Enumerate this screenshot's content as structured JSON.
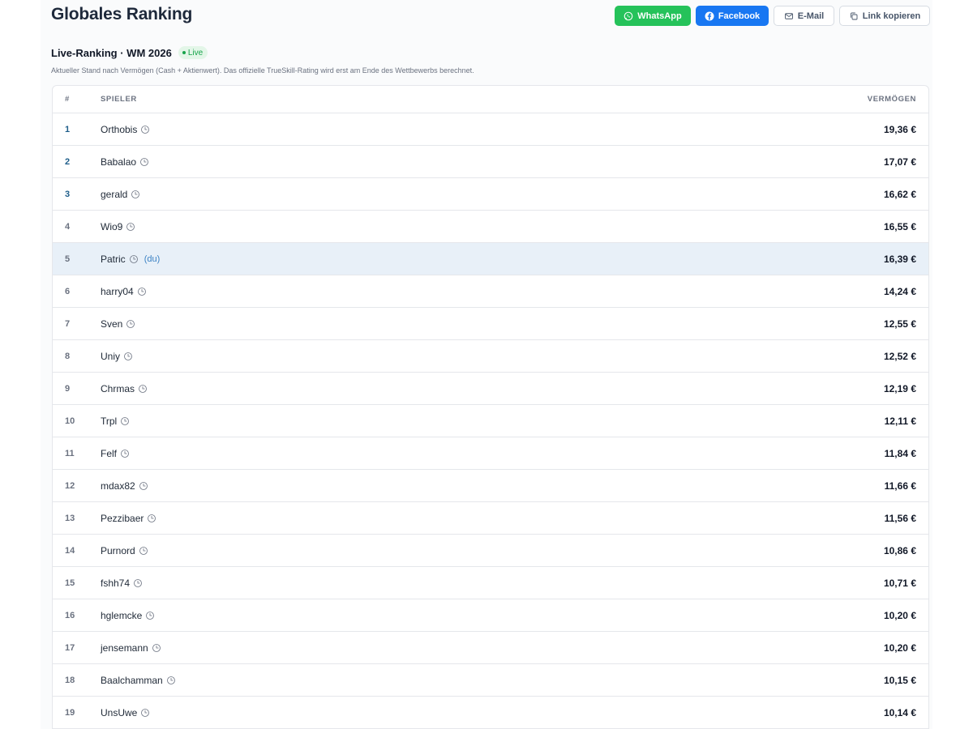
{
  "header": {
    "title": "Globales Ranking",
    "share": {
      "whatsapp": "WhatsApp",
      "facebook": "Facebook",
      "email": "E-Mail",
      "copy_link": "Link kopieren"
    }
  },
  "section": {
    "title": "Live-Ranking · WM 2026",
    "badge": "Live",
    "subtitle": "Aktueller Stand nach Vermögen (Cash + Aktienwert). Das offizielle TrueSkill-Rating wird erst am Ende des Wettbewerbs berechnet."
  },
  "table": {
    "columns": {
      "rank": "#",
      "player": "SPIELER",
      "assets": "VERMÖGEN"
    },
    "you_label": "(du)",
    "rows": [
      {
        "rank": "1",
        "name": "Orthobis",
        "assets": "19,36 €"
      },
      {
        "rank": "2",
        "name": "Babalao",
        "assets": "17,07 €"
      },
      {
        "rank": "3",
        "name": "gerald",
        "assets": "16,62 €"
      },
      {
        "rank": "4",
        "name": "Wio9",
        "assets": "16,55 €"
      },
      {
        "rank": "5",
        "name": "Patric",
        "assets": "16,39 €",
        "is_you": true
      },
      {
        "rank": "6",
        "name": "harry04",
        "assets": "14,24 €"
      },
      {
        "rank": "7",
        "name": "Sven",
        "assets": "12,55 €"
      },
      {
        "rank": "8",
        "name": "Uniy",
        "assets": "12,52 €"
      },
      {
        "rank": "9",
        "name": "Chrmas",
        "assets": "12,19 €"
      },
      {
        "rank": "10",
        "name": "Trpl",
        "assets": "12,11 €"
      },
      {
        "rank": "11",
        "name": "Felf",
        "assets": "11,84 €"
      },
      {
        "rank": "12",
        "name": "mdax82",
        "assets": "11,66 €"
      },
      {
        "rank": "13",
        "name": "Pezzibaer",
        "assets": "11,56 €"
      },
      {
        "rank": "14",
        "name": "Purnord",
        "assets": "10,86 €"
      },
      {
        "rank": "15",
        "name": "fshh74",
        "assets": "10,71 €"
      },
      {
        "rank": "16",
        "name": "hglemcke",
        "assets": "10,20 €"
      },
      {
        "rank": "17",
        "name": "jensemann",
        "assets": "10,20 €"
      },
      {
        "rank": "18",
        "name": "Baalchamman",
        "assets": "10,15 €"
      },
      {
        "rank": "19",
        "name": "UnsUwe",
        "assets": "10,14 €"
      }
    ]
  },
  "colors": {
    "whatsapp": "#25c25a",
    "facebook": "#1877f2",
    "live": "#16a34a",
    "current_row": "#e8f0f8",
    "top_rank": "#1f5e8a"
  },
  "icons": {
    "row_status": "clock-icon",
    "whatsapp": "whatsapp-icon",
    "facebook": "facebook-icon",
    "email": "mail-icon",
    "copy": "copy-icon"
  }
}
